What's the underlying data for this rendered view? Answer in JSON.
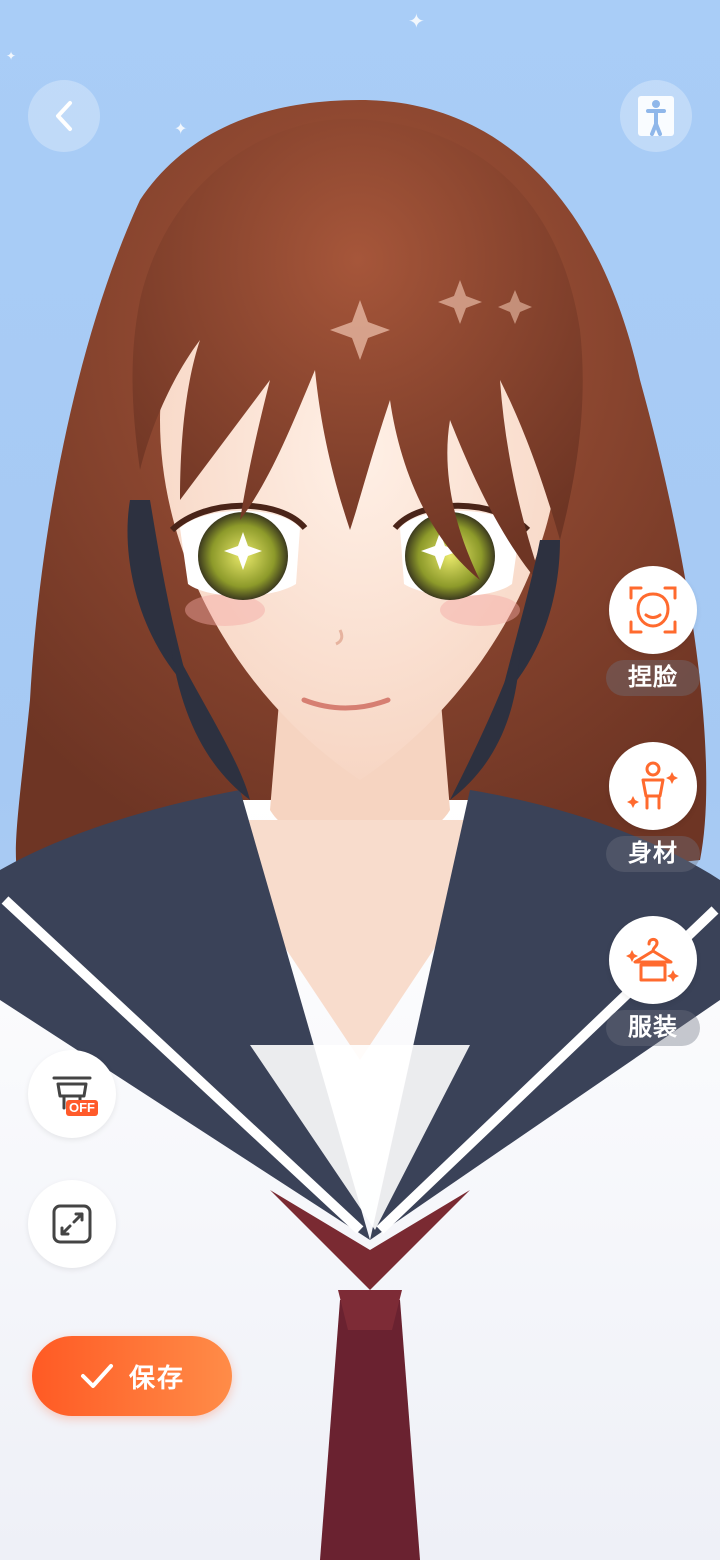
{
  "top_bar": {
    "back_icon": "chevron-left-icon",
    "body_view_icon": "full-body-view-icon"
  },
  "side_menu": [
    {
      "label": "捏脸",
      "icon": "face-scan-icon"
    },
    {
      "label": "身材",
      "icon": "body-figure-icon"
    },
    {
      "label": "服装",
      "icon": "clothes-hanger-icon"
    }
  ],
  "tools": {
    "background_toggle_tag": "OFF",
    "background_toggle_icon": "display-stand-off-icon",
    "fullscreen_icon": "expand-icon"
  },
  "save_button": {
    "label": "保存",
    "icon": "checkmark-icon"
  },
  "colors": {
    "accent": "#ff6a2e",
    "background": "#a9cdf7"
  }
}
